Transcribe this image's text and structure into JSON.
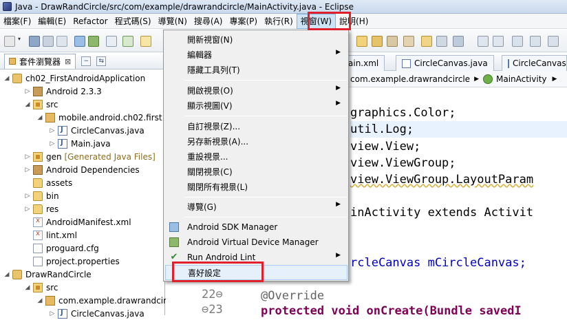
{
  "window": {
    "title": "Java - DrawRandCircle/src/com/example/drawrandcircle/MainActivity.java - Eclipse"
  },
  "menubar": [
    "檔案(F)",
    "編輯(E)",
    "Refactor",
    "程式碼(S)",
    "導覽(N)",
    "搜尋(A)",
    "專案(P)",
    "執行(R)",
    "視窗(W)",
    "說明(H)"
  ],
  "explorer": {
    "tab_label": "套件瀏覽器",
    "close_glyph": "⊠",
    "items": [
      {
        "label": "ch02_FirstAndroidApplication"
      },
      {
        "label": "Android 2.3.3"
      },
      {
        "label": "src"
      },
      {
        "label": "mobile.android.ch02.first"
      },
      {
        "label": "CircleCanvas.java"
      },
      {
        "label": "Main.java"
      },
      {
        "label": "gen",
        "extra": "[Generated Java Files]"
      },
      {
        "label": "Android Dependencies"
      },
      {
        "label": "assets"
      },
      {
        "label": "bin"
      },
      {
        "label": "res"
      },
      {
        "label": "AndroidManifest.xml"
      },
      {
        "label": "lint.xml"
      },
      {
        "label": "proguard.cfg"
      },
      {
        "label": "project.properties"
      },
      {
        "label": "DrawRandCircle"
      },
      {
        "label": "src"
      },
      {
        "label": "com.example.drawrandcircle"
      },
      {
        "label": "CircleCanvas.java"
      }
    ]
  },
  "editor": {
    "tabs": [
      "ain.xml",
      "CircleCanvas.java",
      "CircleCanvas.java"
    ],
    "breadcrumb": [
      "com.example.drawrandcircle",
      "MainActivity"
    ],
    "code_lines": [
      "graphics.Color;",
      "util.Log;",
      "view.View;",
      "view.ViewGroup;",
      "view.ViewGroup.LayoutParam",
      "inActivity extends Activit",
      "rcleCanvas mCircleCanvas;",
      "@Override",
      "protected void onCreate(Bundle savedI"
    ],
    "line_numbers": [
      "22⊖",
      "⊖23"
    ]
  },
  "window_menu": {
    "items": [
      {
        "label": "開新視窗(N)"
      },
      {
        "label": "編輯器"
      },
      {
        "label": "隱藏工具列(T)"
      },
      {
        "label": "開啟視景(O)"
      },
      {
        "label": "顯示視圖(V)"
      },
      {
        "label": "自訂視景(Z)..."
      },
      {
        "label": "另存新視景(A)..."
      },
      {
        "label": "重設視景..."
      },
      {
        "label": "關閉視景(C)"
      },
      {
        "label": "關閉所有視景(L)"
      },
      {
        "label": "導覽(G)"
      },
      {
        "label": "Android SDK Manager"
      },
      {
        "label": "Android Virtual Device Manager"
      },
      {
        "label": "Run Android Lint"
      },
      {
        "label": "喜好設定"
      }
    ]
  },
  "colors": {
    "highlight_box": "#e0202a",
    "menu_bg": "#f0f0f0",
    "keyword": "#7f0055"
  }
}
